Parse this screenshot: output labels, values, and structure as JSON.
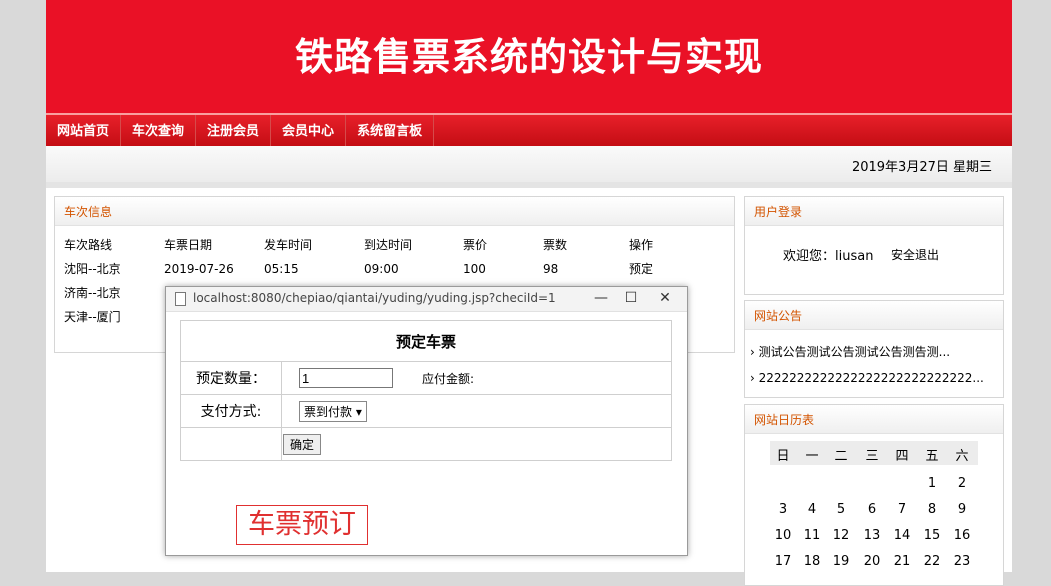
{
  "banner": {
    "title": "铁路售票系统的设计与实现"
  },
  "nav": [
    "网站首页",
    "车次查询",
    "注册会员",
    "会员中心",
    "系统留言板"
  ],
  "date_text": "2019年3月27日 星期三",
  "train_panel": {
    "title": "车次信息",
    "headers": [
      "车次路线",
      "车票日期",
      "发车时间",
      "到达时间",
      "票价",
      "票数",
      "操作"
    ],
    "rows": [
      [
        "沈阳--北京",
        "2019-07-26",
        "05:15",
        "09:00",
        "100",
        "98",
        "预定"
      ],
      [
        "济南--北京",
        "",
        "",
        "",
        "",
        "",
        ""
      ],
      [
        "天津--厦门",
        "",
        "",
        "",
        "",
        "",
        ""
      ]
    ]
  },
  "login_panel": {
    "title": "用户登录",
    "welcome": "欢迎您：",
    "user": "liusan",
    "logout": "安全退出"
  },
  "notice_panel": {
    "title": "网站公告",
    "items": [
      "测试公告测试公告测试公告测告测...",
      "2222222222222222222222222222..."
    ]
  },
  "calendar_panel": {
    "title": "网站日历表",
    "weekdays": [
      "日",
      "一",
      "二",
      "三",
      "四",
      "五",
      "六"
    ],
    "weeks": [
      [
        "",
        "",
        "",
        "",
        "",
        "1",
        "2"
      ],
      [
        "3",
        "4",
        "5",
        "6",
        "7",
        "8",
        "9"
      ],
      [
        "10",
        "11",
        "12",
        "13",
        "14",
        "15",
        "16"
      ],
      [
        "17",
        "18",
        "19",
        "20",
        "21",
        "22",
        "23"
      ]
    ]
  },
  "dialog": {
    "url": "localhost:8080/chepiao/qiantai/yuding/yuding.jsp?checiId=1",
    "heading": "预定车票",
    "qty_label": "预定数量：",
    "qty_value": "1",
    "amount_label": "应付金额:",
    "pay_label": "支付方式:",
    "pay_option": "票到付款",
    "confirm_label": "确定"
  },
  "annotation": {
    "text": "车票预订",
    "color": "#e03030"
  },
  "colors": {
    "accent": "#ea1126",
    "panel_title": "#d35400"
  }
}
